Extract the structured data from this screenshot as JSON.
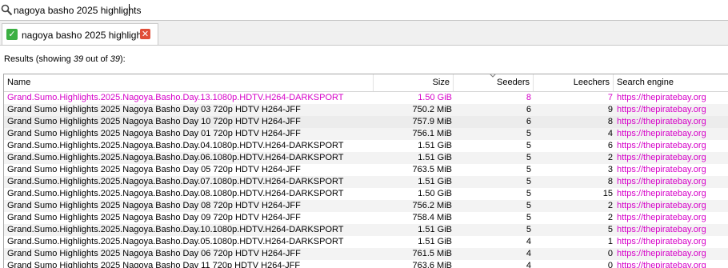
{
  "search": {
    "value": "nagoya basho 2025 highlights",
    "icon": "magnifier-icon"
  },
  "tabs": [
    {
      "label": "nagoya basho 2025 highlights",
      "status_icon": "check-icon",
      "close_icon": "close-icon"
    }
  ],
  "results": {
    "prefix": "Results (showing ",
    "shown": "39",
    "middle": " out of ",
    "total": "39",
    "suffix": "):"
  },
  "columns": {
    "name": "Name",
    "size": "Size",
    "seeders": "Seeders",
    "leechers": "Leechers",
    "engine": "Search engine"
  },
  "colors": {
    "highlight_row": "#d600c8",
    "link": "#d600c8",
    "check": "#3cb043",
    "close": "#e04e39"
  },
  "rows": [
    {
      "name": "Grand.Sumo.Highlights.2025.Nagoya.Basho.Day.13.1080p.HDTV.H264-DARKSPORT",
      "size": "1.50 GiB",
      "seeders": "8",
      "leechers": "7",
      "engine": "https://thepiratebay.org",
      "highlight": true
    },
    {
      "name": "Grand Sumo Highlights 2025 Nagoya Basho Day 03 720p HDTV H264-JFF",
      "size": "750.2 MiB",
      "seeders": "6",
      "leechers": "9",
      "engine": "https://thepiratebay.org"
    },
    {
      "name": "Grand Sumo Highlights 2025 Nagoya Basho Day 10 720p HDTV H264-JFF",
      "size": "757.9 MiB",
      "seeders": "6",
      "leechers": "8",
      "engine": "https://thepiratebay.org",
      "selected": true
    },
    {
      "name": "Grand Sumo Highlights 2025 Nagoya Basho Day 01 720p HDTV H264-JFF",
      "size": "756.1 MiB",
      "seeders": "5",
      "leechers": "4",
      "engine": "https://thepiratebay.org"
    },
    {
      "name": "Grand.Sumo.Highlights.2025.Nagoya.Basho.Day.04.1080p.HDTV.H264-DARKSPORT",
      "size": "1.51 GiB",
      "seeders": "5",
      "leechers": "6",
      "engine": "https://thepiratebay.org"
    },
    {
      "name": "Grand.Sumo.Highlights.2025.Nagoya.Basho.Day.06.1080p.HDTV.H264-DARKSPORT",
      "size": "1.51 GiB",
      "seeders": "5",
      "leechers": "2",
      "engine": "https://thepiratebay.org"
    },
    {
      "name": "Grand Sumo Highlights 2025 Nagoya Basho Day 05 720p HDTV H264-JFF",
      "size": "763.5 MiB",
      "seeders": "5",
      "leechers": "3",
      "engine": "https://thepiratebay.org"
    },
    {
      "name": "Grand.Sumo.Highlights.2025.Nagoya.Basho.Day.07.1080p.HDTV.H264-DARKSPORT",
      "size": "1.51 GiB",
      "seeders": "5",
      "leechers": "8",
      "engine": "https://thepiratebay.org"
    },
    {
      "name": "Grand.Sumo.Highlights.2025.Nagoya.Basho.Day.08.1080p.HDTV.H264-DARKSPORT",
      "size": "1.50 GiB",
      "seeders": "5",
      "leechers": "15",
      "engine": "https://thepiratebay.org"
    },
    {
      "name": "Grand Sumo Highlights 2025 Nagoya Basho Day 08 720p HDTV H264-JFF",
      "size": "756.2 MiB",
      "seeders": "5",
      "leechers": "2",
      "engine": "https://thepiratebay.org"
    },
    {
      "name": "Grand Sumo Highlights 2025 Nagoya Basho Day 09 720p HDTV H264-JFF",
      "size": "758.4 MiB",
      "seeders": "5",
      "leechers": "2",
      "engine": "https://thepiratebay.org"
    },
    {
      "name": "Grand.Sumo.Highlights.2025.Nagoya.Basho.Day.10.1080p.HDTV.H264-DARKSPORT",
      "size": "1.51 GiB",
      "seeders": "5",
      "leechers": "5",
      "engine": "https://thepiratebay.org"
    },
    {
      "name": "Grand.Sumo.Highlights.2025.Nagoya.Basho.Day.05.1080p.HDTV.H264-DARKSPORT",
      "size": "1.51 GiB",
      "seeders": "4",
      "leechers": "1",
      "engine": "https://thepiratebay.org"
    },
    {
      "name": "Grand Sumo Highlights 2025 Nagoya Basho Day 06 720p HDTV H264-JFF",
      "size": "761.5 MiB",
      "seeders": "4",
      "leechers": "0",
      "engine": "https://thepiratebay.org"
    },
    {
      "name": "Grand Sumo Highlights 2025 Nagoya Basho Day 11 720p HDTV H264-JFF",
      "size": "763.6 MiB",
      "seeders": "4",
      "leechers": "0",
      "engine": "https://thepiratebay.org"
    }
  ]
}
